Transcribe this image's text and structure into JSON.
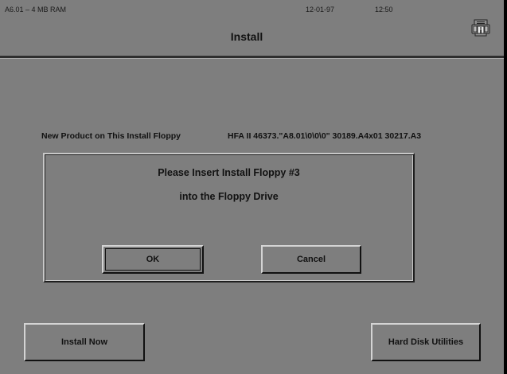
{
  "status_bar": {
    "version_info": "A6.01 – 4 MB RAM",
    "date": "12-01-97",
    "time": "12:50"
  },
  "header": {
    "title": "Install",
    "icon": "info-printer-icon"
  },
  "product_info": {
    "label": "New Product on This Install Floppy",
    "value": "HFA II 46373.\"A8.01\\0\\0\\0\" 30189.A4x01 30217.A3"
  },
  "dialog": {
    "line1": "Please Insert Install Floppy #3",
    "line2": "into the Floppy Drive",
    "ok_label": "OK",
    "cancel_label": "Cancel"
  },
  "footer": {
    "install_now_label": "Install Now",
    "hard_disk_utilities_label": "Hard Disk Utilities"
  },
  "colors": {
    "background": "#7e7e7e",
    "text": "#111111"
  }
}
